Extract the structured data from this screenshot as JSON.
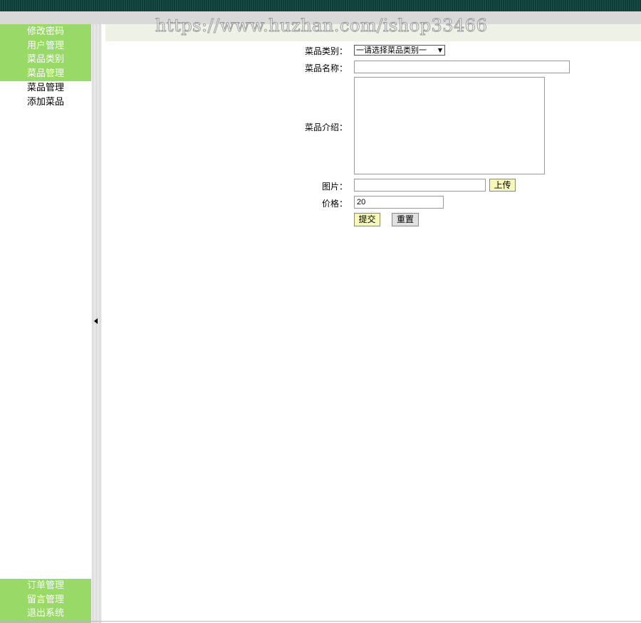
{
  "watermark": "https://www.huzhan.com/ishop33466",
  "sidebar": {
    "top_items": [
      {
        "label": "修改密码"
      },
      {
        "label": "用户管理"
      },
      {
        "label": "菜品类别"
      },
      {
        "label": "菜品管理"
      }
    ],
    "sub_items": [
      {
        "label": "菜品管理"
      },
      {
        "label": "添加菜品"
      }
    ],
    "bottom_items": [
      {
        "label": "订单管理"
      },
      {
        "label": "留言管理"
      },
      {
        "label": "退出系统"
      }
    ]
  },
  "form": {
    "category_label": "菜品类别：",
    "category_selected": "一请选择菜品类别一",
    "name_label": "菜品名称：",
    "name_value": "",
    "intro_label": "菜品介绍：",
    "intro_value": "",
    "image_label": "图片：",
    "image_value": "",
    "upload_label": "上传",
    "price_label": "价格：",
    "price_value": "20",
    "submit_label": "提交",
    "reset_label": "重置"
  },
  "colors": {
    "topbar": "#0d3f38",
    "menu_green": "#98d968",
    "header_bg": "#eef2e6",
    "button_yellow": "#f6f9b8",
    "button_gray": "#e0e0e0"
  }
}
